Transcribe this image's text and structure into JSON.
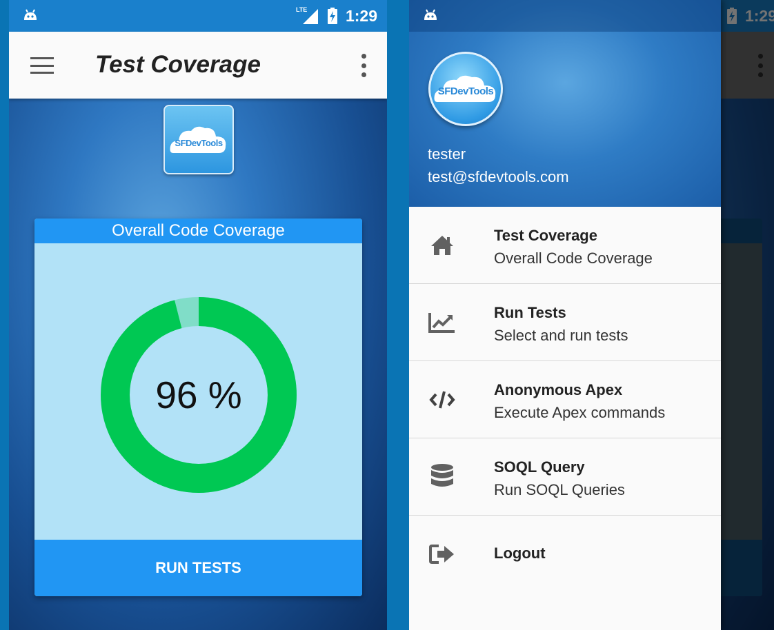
{
  "status_bar": {
    "network": "LTE",
    "time": "1:29"
  },
  "left_screen": {
    "toolbar": {
      "title": "Test Coverage"
    },
    "logo": {
      "text": "SFDevTools"
    },
    "coverage_card": {
      "title": "Overall Code Coverage",
      "percent": 96,
      "percent_label": "96 %",
      "button_label": "RUN TESTS",
      "colors": {
        "covered": "#00c853",
        "uncovered": "#80ddc8",
        "header": "#2196f3",
        "body": "#b2e2f7"
      }
    }
  },
  "drawer": {
    "avatar_text": "SFDevTools",
    "user": {
      "name": "tester",
      "email": "test@sfdevtools.com"
    },
    "items": [
      {
        "icon": "home-icon",
        "title": "Test Coverage",
        "subtitle": "Overall Code Coverage"
      },
      {
        "icon": "chart-line-icon",
        "title": "Run Tests",
        "subtitle": "Select and run tests"
      },
      {
        "icon": "code-icon",
        "title": "Anonymous Apex",
        "subtitle": "Execute Apex commands"
      },
      {
        "icon": "database-icon",
        "title": "SOQL Query",
        "subtitle": "Run SOQL Queries"
      },
      {
        "icon": "logout-icon",
        "title": "Logout",
        "subtitle": ""
      }
    ]
  }
}
